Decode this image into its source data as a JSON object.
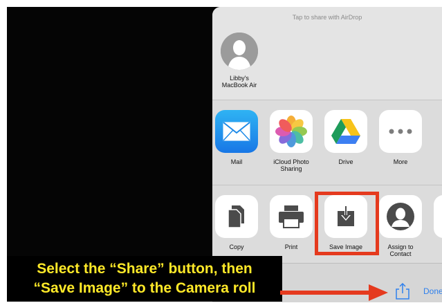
{
  "airdrop": {
    "header": "Tap to share with AirDrop",
    "device": {
      "name_line1": "Libby's",
      "name_line2": "MacBook Air"
    }
  },
  "share_row": [
    {
      "label": "Mail",
      "icon": "mail-icon"
    },
    {
      "label_line1": "iCloud Photo",
      "label_line2": "Sharing",
      "icon": "photos-icon"
    },
    {
      "label": "Drive",
      "icon": "drive-icon"
    },
    {
      "label": "More",
      "icon": "more-icon"
    }
  ],
  "action_row": [
    {
      "label": "Copy",
      "icon": "copy-icon"
    },
    {
      "label": "Print",
      "icon": "print-icon"
    },
    {
      "label": "Save Image",
      "icon": "save-image-icon"
    },
    {
      "label_line1": "Assign to",
      "label_line2": "Contact",
      "icon": "contact-icon"
    }
  ],
  "bottom_bar": {
    "done_label": "Done",
    "share_icon": "share-icon"
  },
  "annotation": {
    "line1": "Select the “Share” button, then",
    "line2": "“Save Image” to the Camera roll",
    "text_color": "#ffe928",
    "highlight_color": "#e53a1e"
  }
}
